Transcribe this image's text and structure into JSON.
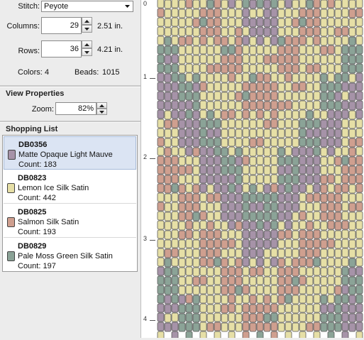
{
  "stitch": {
    "label": "Stitch:",
    "value": "Peyote"
  },
  "columns": {
    "label": "Columns:",
    "value": "29",
    "inches": "2.51 in."
  },
  "rows": {
    "label": "Rows:",
    "value": "36",
    "inches": "4.21 in."
  },
  "stats": {
    "colors_label": "Colors:",
    "colors_value": "4",
    "beads_label": "Beads:",
    "beads_value": "1015"
  },
  "view": {
    "title": "View Properties",
    "zoom_label": "Zoom:",
    "zoom_value": "82%"
  },
  "shopping": {
    "title": "Shopping List",
    "items": [
      {
        "code": "DB0356",
        "name": "Matte Opaque Light Mauve",
        "count": "Count: 183",
        "color": "#a693a8"
      },
      {
        "code": "DB0823",
        "name": "Lemon Ice Silk Satin",
        "count": "Count: 442",
        "color": "#e6dfa6"
      },
      {
        "code": "DB0825",
        "name": "Salmon Silk Satin",
        "count": "Count: 193",
        "color": "#cf9f8f"
      },
      {
        "code": "DB0829",
        "name": "Pale Moss Green Silk Satin",
        "count": "Count: 197",
        "color": "#8ba397"
      }
    ]
  },
  "ruler": {
    "labels": [
      "0",
      "1",
      "2",
      "3",
      "4"
    ]
  },
  "bead_pattern": {
    "palette": [
      "#a693a8",
      "#e6dfa6",
      "#cf9f8f",
      "#8ba397"
    ],
    "columns": 29,
    "rows": 36
  }
}
